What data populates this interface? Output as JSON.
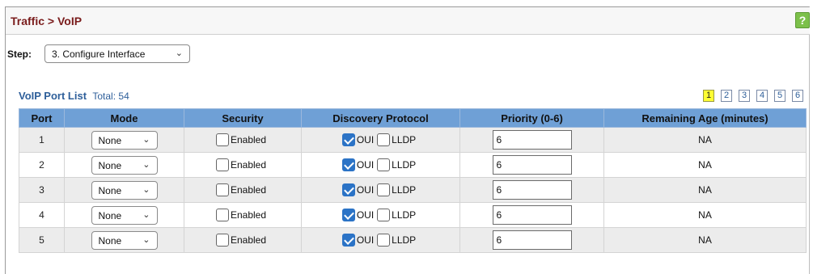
{
  "breadcrumb": "Traffic > VoIP",
  "help_icon_label": "?",
  "step": {
    "label": "Step:",
    "value": "3. Configure Interface"
  },
  "list": {
    "title": "VoIP Port List",
    "total": "Total: 54"
  },
  "pager": {
    "pages": [
      "1",
      "2",
      "3",
      "4",
      "5",
      "6"
    ],
    "active": "1"
  },
  "columns": [
    "Port",
    "Mode",
    "Security",
    "Discovery Protocol",
    "Priority (0-6)",
    "Remaining Age (minutes)"
  ],
  "labels": {
    "enabled": "Enabled",
    "oui": "OUI",
    "lldp": "LLDP"
  },
  "rows": [
    {
      "port": "1",
      "mode": "None",
      "security_enabled": false,
      "oui": true,
      "lldp": false,
      "priority": "6",
      "age": "NA"
    },
    {
      "port": "2",
      "mode": "None",
      "security_enabled": false,
      "oui": true,
      "lldp": false,
      "priority": "6",
      "age": "NA"
    },
    {
      "port": "3",
      "mode": "None",
      "security_enabled": false,
      "oui": true,
      "lldp": false,
      "priority": "6",
      "age": "NA"
    },
    {
      "port": "4",
      "mode": "None",
      "security_enabled": false,
      "oui": true,
      "lldp": false,
      "priority": "6",
      "age": "NA"
    },
    {
      "port": "5",
      "mode": "None",
      "security_enabled": false,
      "oui": true,
      "lldp": false,
      "priority": "6",
      "age": "NA"
    }
  ],
  "colors": {
    "title": "#7a1c1c",
    "header_bg": "#6fa0d6",
    "link": "#2e5f9a",
    "checked": "#2b73c6",
    "pager_active": "#ffff33"
  }
}
